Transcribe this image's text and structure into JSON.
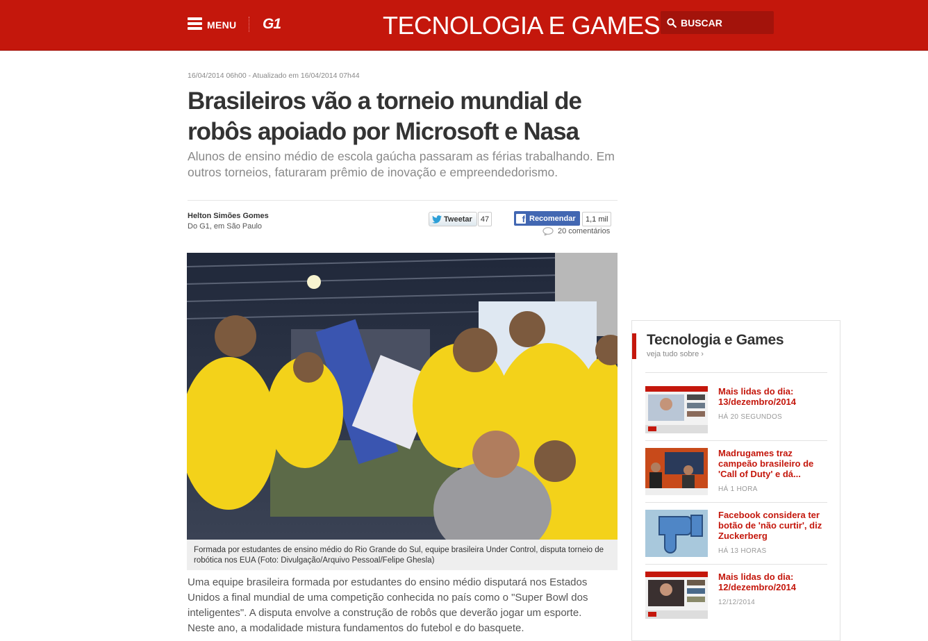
{
  "header": {
    "menu_label": "MENU",
    "logo": "G1",
    "section_title": "TECNOLOGIA E GAMES",
    "search_label": "BUSCAR"
  },
  "article": {
    "date": "16/04/2014 06h00 - Atualizado em 16/04/2014 07h44",
    "title": "Brasileiros vão a torneio mundial de robôs apoiado por Microsoft e Nasa",
    "subtitle": "Alunos de ensino médio de escola gaúcha passaram as férias trabalhando. Em outros torneios, faturaram prêmio de inovação e empreendedorismo.",
    "author": "Helton Simões Gomes",
    "author_source": "Do G1, em São Paulo",
    "caption": "Formada por estudantes de ensino médio do Rio Grande do Sul, equipe brasileira Under Control, disputa torneio de robótica nos EUA (Foto: Divulgação/Arquivo Pessoal/Felipe Ghesla)",
    "body": "Uma equipe brasileira formada por estudantes do ensino médio disputará nos Estados Unidos a final mundial de uma competição conhecida no país como o \"Super Bowl dos inteligentes\". A disputa envolve a construção de robôs que deverão jogar um esporte. Neste ano, a modalidade mistura fundamentos do futebol e do basquete."
  },
  "social": {
    "tweet_label": "Tweetar",
    "tweet_count": "47",
    "fb_label": "Recomendar",
    "fb_count": "1,1 mil",
    "comments_label": "20 comentários"
  },
  "sidebar": {
    "title": "Tecnologia e Games",
    "see_all": "veja tudo sobre ›",
    "items": [
      {
        "headline": "Mais lidas do dia: 13/dezembro/2014",
        "time": "HÁ 20 SEGUNDOS"
      },
      {
        "headline": "Madrugames traz campeão brasileiro de 'Call of Duty' e dá...",
        "time": "HÁ 1 HORA"
      },
      {
        "headline": "Facebook considera ter botão de 'não curtir', diz Zuckerberg",
        "time": "HÁ 13 HORAS"
      },
      {
        "headline": "Mais lidas do dia: 12/dezembro/2014",
        "time": "12/12/2014"
      }
    ]
  },
  "colors": {
    "brand_red": "#c4170c",
    "facebook_blue": "#4267b2"
  }
}
